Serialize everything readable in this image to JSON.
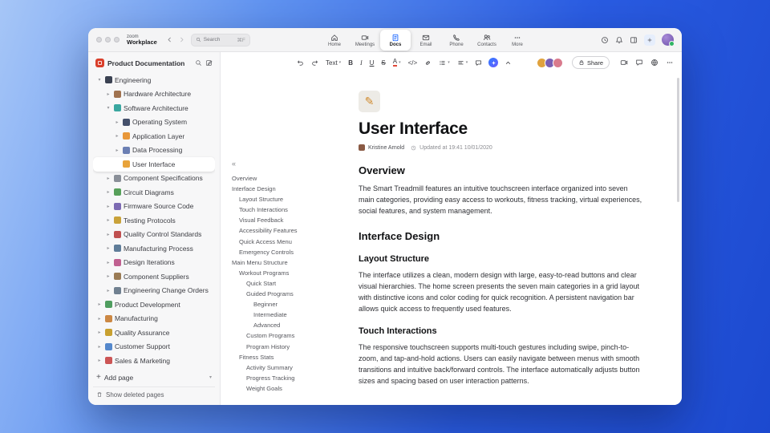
{
  "titlebar": {
    "logo_top": "zoom",
    "logo_bottom": "Workplace",
    "search": {
      "placeholder": "Search",
      "shortcut": "⌘F"
    },
    "tabs": [
      {
        "label": "Home",
        "icon": "home",
        "active": false
      },
      {
        "label": "Meetings",
        "icon": "meetings",
        "active": false
      },
      {
        "label": "Docs",
        "icon": "docs",
        "active": true
      },
      {
        "label": "Email",
        "icon": "email",
        "active": false
      },
      {
        "label": "Phone",
        "icon": "phone",
        "active": false
      },
      {
        "label": "Contacts",
        "icon": "contacts",
        "active": false
      },
      {
        "label": "More",
        "icon": "more",
        "active": false
      }
    ],
    "right_icons": [
      {
        "name": "recents-button",
        "icon": "clock"
      },
      {
        "name": "notifications-button",
        "icon": "bell"
      },
      {
        "name": "side-panel-button",
        "icon": "panel"
      }
    ]
  },
  "sidebar": {
    "workspace": {
      "title": "Product Documentation",
      "icon_color": "#d93f2b"
    },
    "tree": [
      {
        "label": "Engineering",
        "depth": 0,
        "chevron": "down",
        "color": "#3b4252",
        "selected": false
      },
      {
        "label": "Hardware Architecture",
        "depth": 1,
        "chevron": "right",
        "color": "#a0724f",
        "selected": false
      },
      {
        "label": "Software Architecture",
        "depth": 1,
        "chevron": "down",
        "color": "#3aa7a0",
        "selected": false
      },
      {
        "label": "Operating System",
        "depth": 2,
        "chevron": "right",
        "color": "#44506b",
        "selected": false
      },
      {
        "label": "Application Layer",
        "depth": 2,
        "chevron": "right",
        "color": "#e8973a",
        "selected": false
      },
      {
        "label": "Data Processing",
        "depth": 2,
        "chevron": "right",
        "color": "#6b7fb3",
        "selected": false
      },
      {
        "label": "User Interface",
        "depth": 2,
        "chevron": "none",
        "color": "#e8a33a",
        "selected": true
      },
      {
        "label": "Component Specifications",
        "depth": 1,
        "chevron": "right",
        "color": "#8a8f98",
        "selected": false
      },
      {
        "label": "Circuit Diagrams",
        "depth": 1,
        "chevron": "right",
        "color": "#57a05a",
        "selected": false
      },
      {
        "label": "Firmware Source Code",
        "depth": 1,
        "chevron": "right",
        "color": "#7d6bb3",
        "selected": false
      },
      {
        "label": "Testing Protocols",
        "depth": 1,
        "chevron": "right",
        "color": "#c9a23a",
        "selected": false
      },
      {
        "label": "Quality Control Standards",
        "depth": 1,
        "chevron": "right",
        "color": "#c05050",
        "selected": false
      },
      {
        "label": "Manufacturing Process",
        "depth": 1,
        "chevron": "right",
        "color": "#5f7d99",
        "selected": false
      },
      {
        "label": "Design Iterations",
        "depth": 1,
        "chevron": "right",
        "color": "#c06090",
        "selected": false
      },
      {
        "label": "Component Suppliers",
        "depth": 1,
        "chevron": "right",
        "color": "#9a7b55",
        "selected": false
      },
      {
        "label": "Engineering Change Orders",
        "depth": 1,
        "chevron": "right",
        "color": "#708090",
        "selected": false
      },
      {
        "label": "Product Development",
        "depth": 0,
        "chevron": "right",
        "color": "#4f9d5f",
        "selected": false
      },
      {
        "label": "Manufacturing",
        "depth": 0,
        "chevron": "right",
        "color": "#cc8844",
        "selected": false
      },
      {
        "label": "Quality Assurance",
        "depth": 0,
        "chevron": "right",
        "color": "#c8a030",
        "selected": false
      },
      {
        "label": "Customer Support",
        "depth": 0,
        "chevron": "right",
        "color": "#5588cc",
        "selected": false
      },
      {
        "label": "Sales & Marketing",
        "depth": 0,
        "chevron": "right",
        "color": "#cc5555",
        "selected": false
      }
    ],
    "add_page": "Add page",
    "show_deleted": "Show deleted pages"
  },
  "toolbar": {
    "buttons": [
      {
        "name": "undo",
        "kind": "svg",
        "icon": "undo"
      },
      {
        "name": "redo",
        "kind": "svg",
        "icon": "redo"
      },
      {
        "name": "text-style",
        "kind": "label",
        "label": "Text",
        "dropdown": true
      },
      {
        "name": "bold",
        "kind": "glyph",
        "glyph": "B",
        "style": "bold"
      },
      {
        "name": "italic",
        "kind": "glyph",
        "glyph": "I",
        "style": "italic"
      },
      {
        "name": "underline",
        "kind": "glyph",
        "glyph": "U",
        "style": "underline"
      },
      {
        "name": "strikethrough",
        "kind": "glyph",
        "glyph": "S",
        "style": "strike"
      },
      {
        "name": "text-color",
        "kind": "glyph",
        "glyph": "A",
        "style": "color",
        "dropdown": true
      },
      {
        "name": "code-block",
        "kind": "glyph",
        "glyph": "</>"
      },
      {
        "name": "insert-link",
        "kind": "svg",
        "icon": "link"
      },
      {
        "name": "bullet-list",
        "kind": "svg",
        "icon": "list",
        "dropdown": true
      },
      {
        "name": "align",
        "kind": "svg",
        "icon": "align",
        "dropdown": true
      },
      {
        "name": "comment",
        "kind": "svg",
        "icon": "chat"
      },
      {
        "name": "ai-companion",
        "kind": "ai"
      },
      {
        "name": "collapse-toolbar",
        "kind": "svg",
        "icon": "chevU"
      }
    ],
    "collaborators": [
      {
        "color": "#e0a23e"
      },
      {
        "color": "#7a5fb3"
      },
      {
        "color": "#d97b8d"
      }
    ],
    "share_label": "Share",
    "right_icons": [
      {
        "name": "start-video-button",
        "icon": "video"
      },
      {
        "name": "comments-button",
        "icon": "chat"
      },
      {
        "name": "translate-button",
        "icon": "globe"
      },
      {
        "name": "more-options-button",
        "icon": "more"
      }
    ]
  },
  "toc": {
    "collapse_glyph": "«",
    "items": [
      {
        "label": "Overview",
        "depth": 0
      },
      {
        "label": "Interface Design",
        "depth": 0
      },
      {
        "label": "Layout Structure",
        "depth": 1
      },
      {
        "label": "Touch Interactions",
        "depth": 1
      },
      {
        "label": "Visual Feedback",
        "depth": 1
      },
      {
        "label": "Accessibility Features",
        "depth": 1
      },
      {
        "label": "Quick Access Menu",
        "depth": 1
      },
      {
        "label": "Emergency Controls",
        "depth": 1
      },
      {
        "label": "Main Menu Structure",
        "depth": 0
      },
      {
        "label": "Workout Programs",
        "depth": 1
      },
      {
        "label": "Quick Start",
        "depth": 2
      },
      {
        "label": "Guided Programs",
        "depth": 2
      },
      {
        "label": "Beginner",
        "depth": 3
      },
      {
        "label": "Intermediate",
        "depth": 3
      },
      {
        "label": "Advanced",
        "depth": 3
      },
      {
        "label": "Custom Programs",
        "depth": 2
      },
      {
        "label": "Program History",
        "depth": 2
      },
      {
        "label": "Fitness Stats",
        "depth": 1
      },
      {
        "label": "Activity Summary",
        "depth": 2
      },
      {
        "label": "Progress Tracking",
        "depth": 2
      },
      {
        "label": "Weight Goals",
        "depth": 2
      }
    ]
  },
  "doc": {
    "page_icon_glyph": "✎",
    "title": "User Interface",
    "author": "Kristine Arnold",
    "updated": "Updated at 19:41 10/01/2020",
    "sections": [
      {
        "type": "h2",
        "text": "Overview"
      },
      {
        "type": "p",
        "text": "The Smart Treadmill features an intuitive touchscreen interface organized into seven main categories, providing easy access to workouts, fitness tracking, virtual experiences, social features, and system management."
      },
      {
        "type": "h2",
        "text": "Interface Design"
      },
      {
        "type": "h3",
        "text": "Layout Structure"
      },
      {
        "type": "p",
        "text": "The interface utilizes a clean, modern design with large, easy-to-read buttons and clear visual hierarchies. The home screen presents the seven main categories in a grid layout with distinctive icons and color coding for quick recognition. A persistent navigation bar allows quick access to frequently used features."
      },
      {
        "type": "h3",
        "text": "Touch Interactions"
      },
      {
        "type": "p",
        "text": "The responsive touchscreen supports multi-touch gestures including swipe, pinch-to-zoom, and tap-and-hold actions. Users can easily navigate between menus with smooth transitions and intuitive back/forward controls. The interface automatically adjusts button sizes and spacing based on user interaction patterns."
      }
    ]
  }
}
